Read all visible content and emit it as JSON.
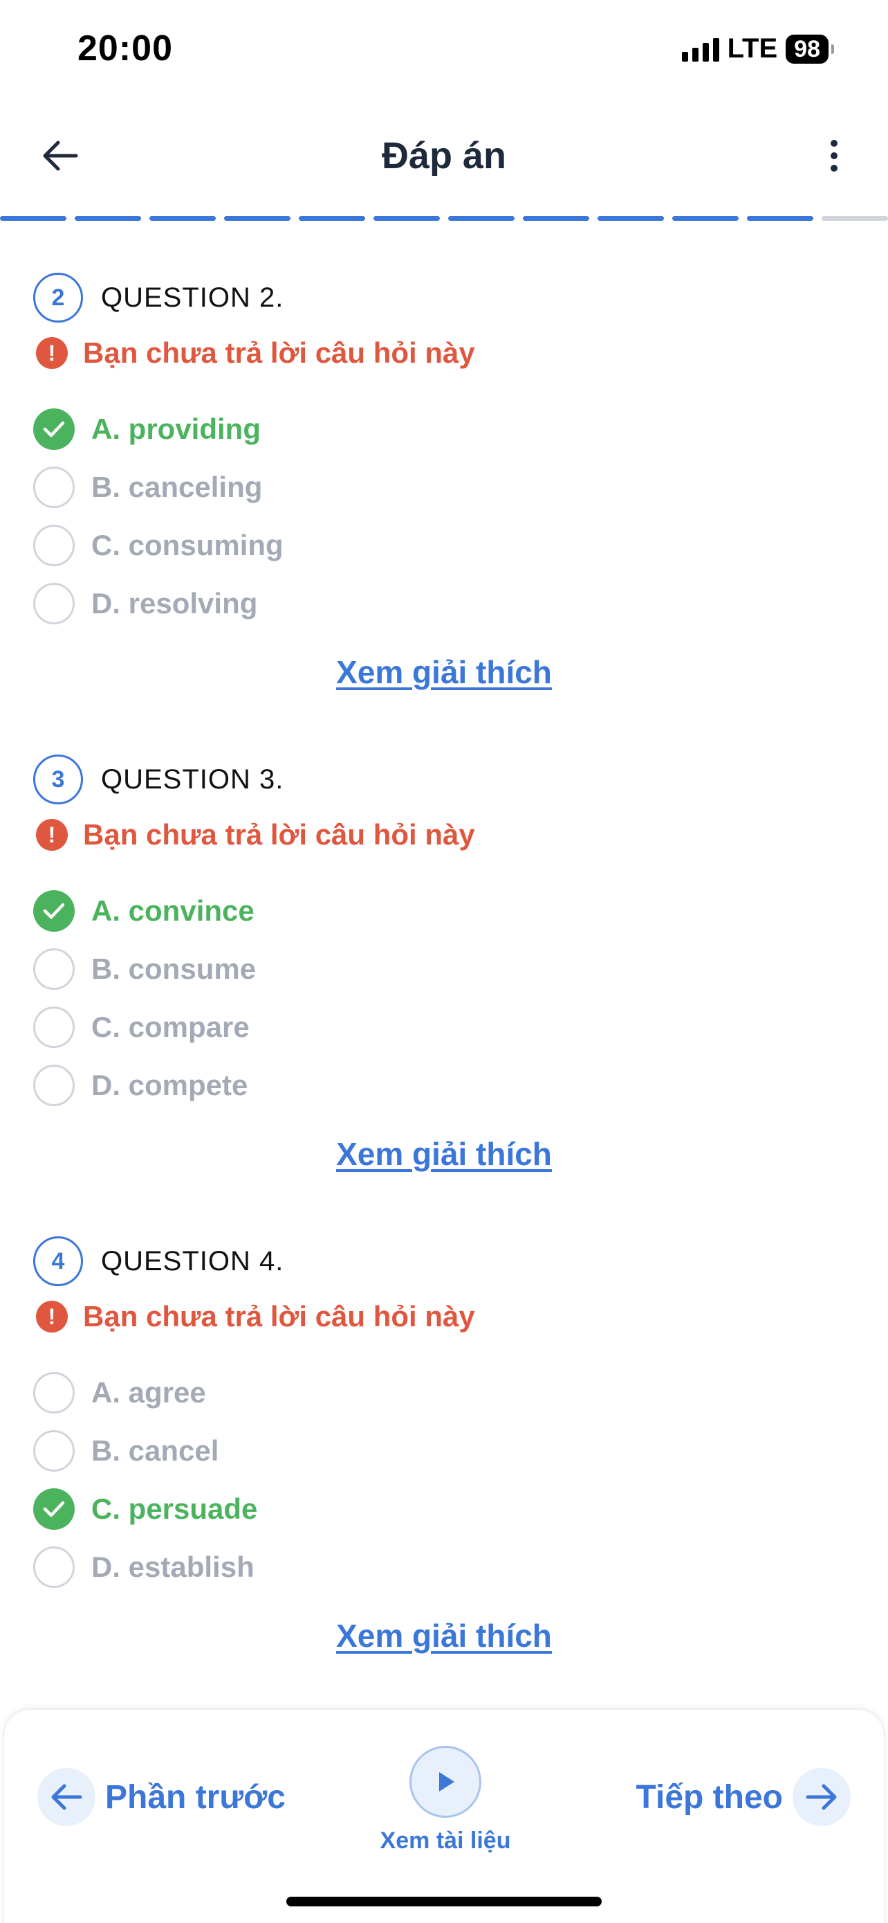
{
  "status_bar": {
    "time": "20:00",
    "network": "LTE",
    "battery": "98"
  },
  "header": {
    "title": "Đáp án",
    "back_icon": "arrow-left-icon",
    "menu_icon": "more-vertical-icon"
  },
  "progress": {
    "completed_segments": 11,
    "total_segments": 12
  },
  "questions": [
    {
      "number": "2",
      "label": "QUESTION 2.",
      "warning": "Bạn chưa trả lời câu hỏi này",
      "options": [
        {
          "text": "A. providing",
          "correct": true
        },
        {
          "text": "B. canceling",
          "correct": false
        },
        {
          "text": "C. consuming",
          "correct": false
        },
        {
          "text": "D. resolving",
          "correct": false
        }
      ],
      "explain_link": "Xem giải thích"
    },
    {
      "number": "3",
      "label": "QUESTION 3.",
      "warning": "Bạn chưa trả lời câu hỏi này",
      "options": [
        {
          "text": "A. convince",
          "correct": true
        },
        {
          "text": "B. consume",
          "correct": false
        },
        {
          "text": "C. compare",
          "correct": false
        },
        {
          "text": "D. compete",
          "correct": false
        }
      ],
      "explain_link": "Xem giải thích"
    },
    {
      "number": "4",
      "label": "QUESTION 4.",
      "warning": "Bạn chưa trả lời câu hỏi này",
      "options": [
        {
          "text": "A. agree",
          "correct": false
        },
        {
          "text": "B. cancel",
          "correct": false
        },
        {
          "text": "C. persuade",
          "correct": true
        },
        {
          "text": "D. establish",
          "correct": false
        }
      ],
      "explain_link": "Xem giải thích"
    }
  ],
  "bottom_bar": {
    "prev_label": "Phần trước",
    "docs_label": "Xem tài liệu",
    "next_label": "Tiếp theo"
  },
  "colors": {
    "accent": "#3b76d9",
    "correct": "#4bb35d",
    "warning": "#e0573f",
    "muted": "#a3aab6"
  }
}
